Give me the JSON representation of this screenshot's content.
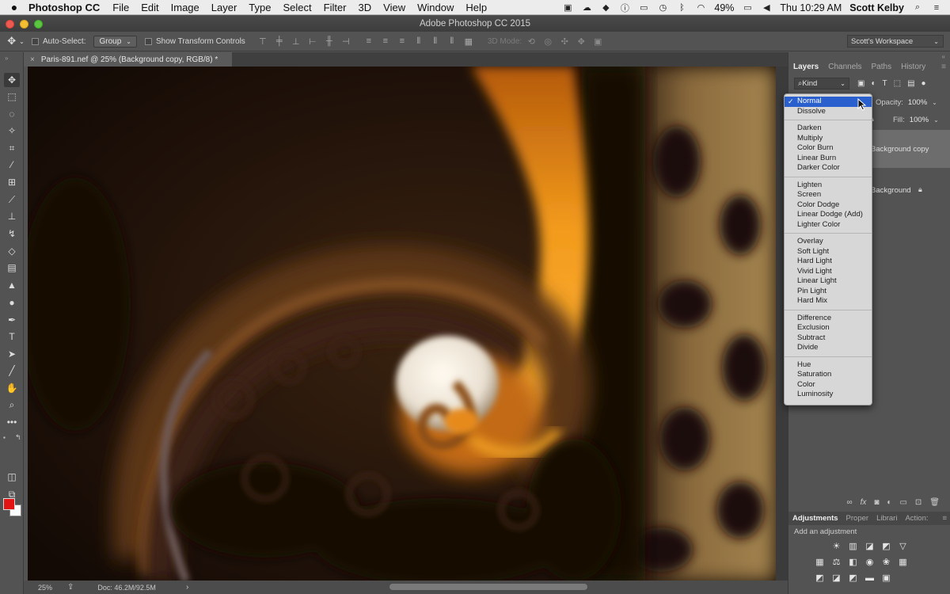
{
  "menubar": {
    "app_name": "Photoshop CC",
    "items": [
      "File",
      "Edit",
      "Image",
      "Layer",
      "Type",
      "Select",
      "Filter",
      "3D",
      "View",
      "Window",
      "Help"
    ],
    "battery": "49%",
    "clock": "Thu 10:29 AM",
    "user": "Scott Kelby"
  },
  "titlebar": {
    "title": "Adobe Photoshop CC 2015"
  },
  "options": {
    "auto_select_label": "Auto-Select:",
    "group_value": "Group",
    "transform_label": "Show Transform Controls",
    "mode_3d_label": "3D Mode:",
    "workspace": "Scott's Workspace"
  },
  "document": {
    "tab_title": "Paris-891.nef @ 25% (Background copy, RGB/8) *"
  },
  "status": {
    "zoom": "25%",
    "doc_size": "Doc: 46.2M/92.5M"
  },
  "layers_panel": {
    "tabs": [
      "Layers",
      "Channels",
      "Paths",
      "History"
    ],
    "filter_kind": "Kind",
    "opacity_label": "Opacity:",
    "opacity_value": "100%",
    "fill_label": "Fill:",
    "fill_value": "100%",
    "layers": [
      {
        "name": "Background copy"
      },
      {
        "name": "Background"
      }
    ]
  },
  "adjustments_panel": {
    "tabs": [
      "Adjustments",
      "Proper",
      "Librari",
      "Action:"
    ],
    "hint": "Add an adjustment"
  },
  "blend_menu": {
    "selected": "Normal",
    "groups": [
      [
        "Normal",
        "Dissolve"
      ],
      [
        "Darken",
        "Multiply",
        "Color Burn",
        "Linear Burn",
        "Darker Color"
      ],
      [
        "Lighten",
        "Screen",
        "Color Dodge",
        "Linear Dodge (Add)",
        "Lighter Color"
      ],
      [
        "Overlay",
        "Soft Light",
        "Hard Light",
        "Vivid Light",
        "Linear Light",
        "Pin Light",
        "Hard Mix"
      ],
      [
        "Difference",
        "Exclusion",
        "Subtract",
        "Divide"
      ],
      [
        "Hue",
        "Saturation",
        "Color",
        "Luminosity"
      ]
    ]
  },
  "colors": {
    "foreground": "#e31414",
    "background": "#ffffff",
    "menu_highlight": "#2a5fce"
  }
}
